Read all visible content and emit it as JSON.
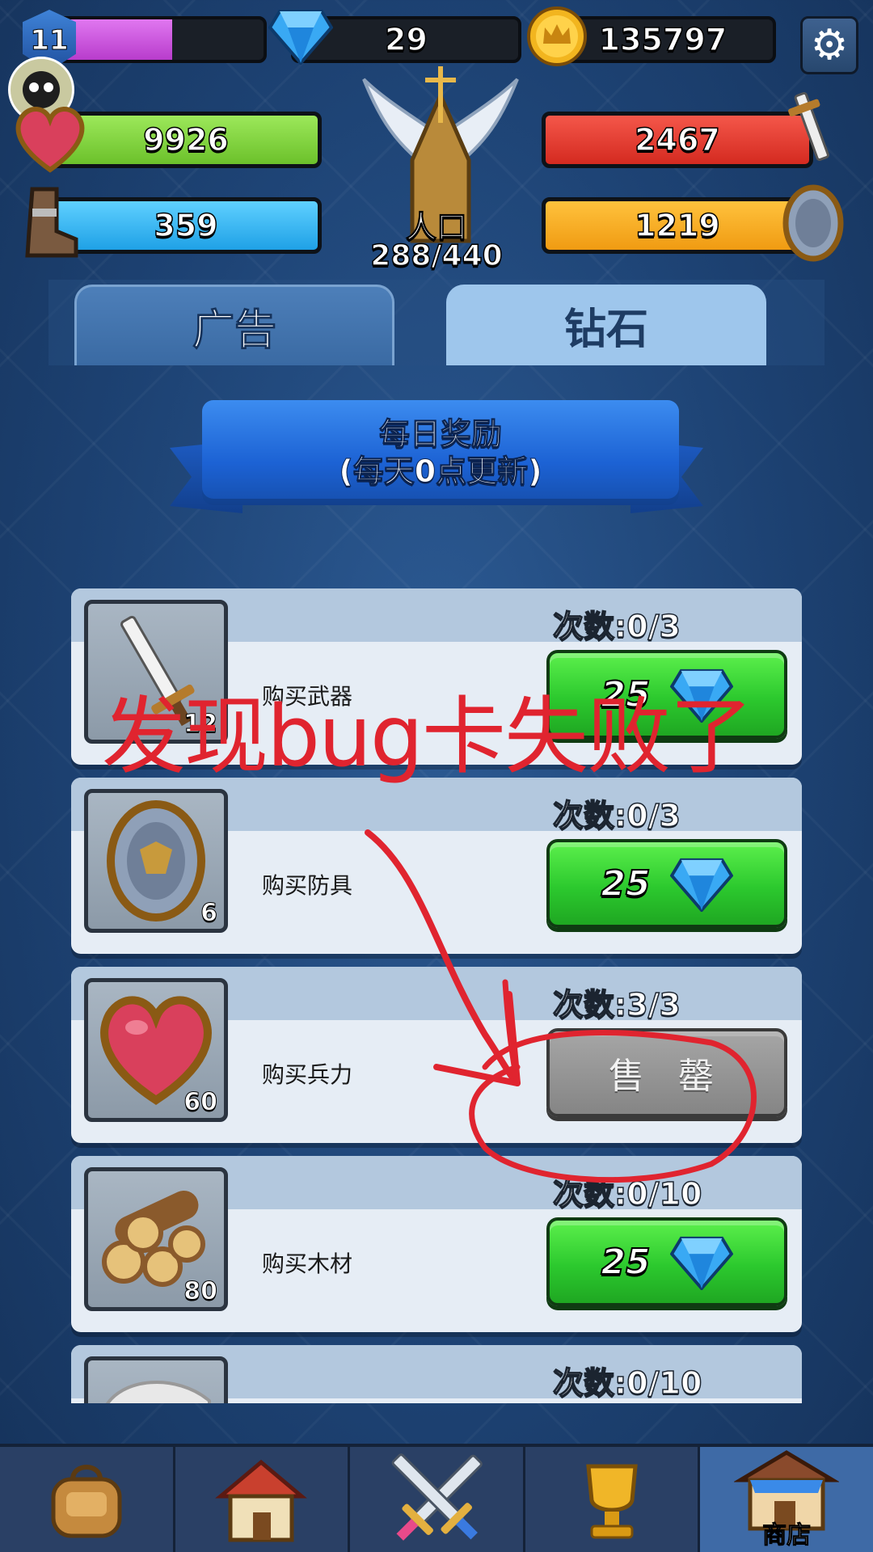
{
  "topbar": {
    "level": "11",
    "xp_fraction": 0.55,
    "gems": "29",
    "gold": "135797"
  },
  "stats": {
    "hp": "9926",
    "attack": "2467",
    "troops": "359",
    "defense": "1219"
  },
  "emblem": {
    "population_label": "人口",
    "population_value": "288/440"
  },
  "tabs": [
    {
      "label": "广告",
      "active": false
    },
    {
      "label": "钻石",
      "active": true
    }
  ],
  "banner": {
    "title": "每日奖励",
    "subtitle": "(每天0点更新)"
  },
  "shop_items": [
    {
      "name": "购买武器",
      "count": "次数:0/3",
      "thumb_count": "12",
      "price": "25",
      "icon": "sword-icon"
    },
    {
      "name": "购买防具",
      "count": "次数:0/3",
      "thumb_count": "6",
      "price": "25",
      "icon": "shield-icon"
    },
    {
      "name": "购买兵力",
      "count": "次数:3/3",
      "thumb_count": "60",
      "sold_label": "售 罄",
      "icon": "heart-icon"
    },
    {
      "name": "购买木材",
      "count": "次数:0/10",
      "thumb_count": "80",
      "price": "25",
      "icon": "wood-logs-icon"
    },
    {
      "name": "",
      "count": "次数:0/10",
      "icon": "stone-icon"
    }
  ],
  "annotation": {
    "text": "发现bug卡失败了",
    "color": "#e0242f"
  },
  "nav": {
    "items": [
      {
        "icon": "backpack-icon"
      },
      {
        "icon": "house-icon"
      },
      {
        "icon": "crossed-swords-icon"
      },
      {
        "icon": "trophy-icon"
      },
      {
        "icon": "shop-icon",
        "label": "商店",
        "active": true
      }
    ]
  },
  "colors": {
    "hp": "#7bd33a",
    "attack": "#e9382b",
    "troops": "#2fb3ee",
    "defense": "#f5a623",
    "xp": "#c24bd8",
    "buy_button": "#2cc92e"
  }
}
